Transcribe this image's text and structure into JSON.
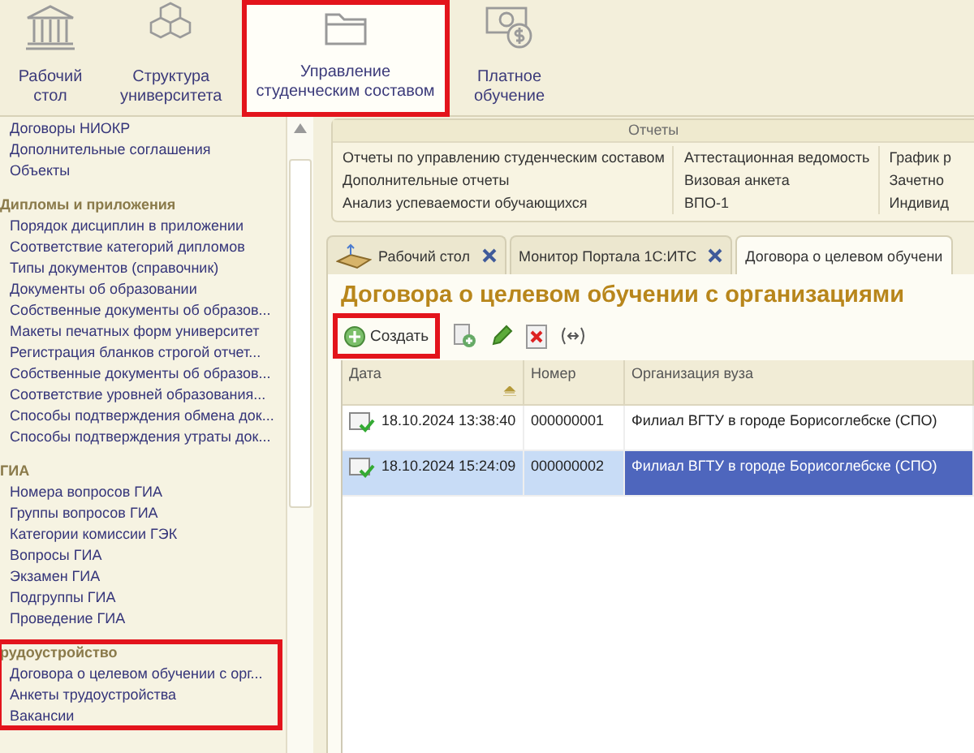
{
  "nav": [
    {
      "kind": "building",
      "lines": [
        "Рабочий",
        "стол"
      ],
      "selected": false,
      "highlighted": false
    },
    {
      "kind": "cubes",
      "lines": [
        "Структура",
        "университета"
      ],
      "selected": false,
      "highlighted": false
    },
    {
      "kind": "folder",
      "lines": [
        "Управление",
        "студенческим составом"
      ],
      "selected": true,
      "highlighted": true
    },
    {
      "kind": "money",
      "lines": [
        "Платное",
        "обучение"
      ],
      "selected": false,
      "highlighted": false
    }
  ],
  "sidebar": {
    "groups": [
      {
        "items": [
          {
            "label": "Договоры НИОКР"
          },
          {
            "label": "Дополнительные соглашения"
          },
          {
            "label": "Объекты"
          }
        ]
      },
      {
        "heading": "Дипломы и приложения",
        "items": [
          {
            "label": "Порядок дисциплин в приложении"
          },
          {
            "label": "Соответствие категорий дипломов"
          },
          {
            "label": "Типы документов (справочник)"
          },
          {
            "label": "Документы об образовании"
          },
          {
            "label": "Собственные документы об образов..."
          },
          {
            "label": "Макеты печатных форм университет"
          },
          {
            "label": "Регистрация бланков строгой отчет..."
          },
          {
            "label": "Собственные документы об образов..."
          },
          {
            "label": "Соответствие уровней образования..."
          },
          {
            "label": "Способы подтверждения обмена док..."
          },
          {
            "label": "Способы подтверждения утраты док..."
          }
        ]
      },
      {
        "heading": "ГИА",
        "items": [
          {
            "label": "Номера вопросов ГИА"
          },
          {
            "label": "Группы вопросов ГИА"
          },
          {
            "label": "Категории комиссии ГЭК"
          },
          {
            "label": "Вопросы ГИА"
          },
          {
            "label": "Экзамен ГИА"
          },
          {
            "label": "Подгруппы ГИА"
          },
          {
            "label": "Проведение ГИА"
          }
        ]
      },
      {
        "heading": "рудоустройство",
        "highlighted": true,
        "items": [
          {
            "label": "Договора о целевом обучении с орг..."
          },
          {
            "label": "Анкеты трудоустройства"
          },
          {
            "label": "Вакансии"
          }
        ]
      }
    ]
  },
  "reports": {
    "title": "Отчеты",
    "columns": [
      [
        "Отчеты по управлению студенческим составом",
        "Дополнительные отчеты",
        "Анализ успеваемости обучающихся"
      ],
      [
        "Аттестационная ведомость",
        "Визовая анкета",
        "ВПО-1"
      ],
      [
        "График р",
        "Зачетно",
        "Индивид"
      ]
    ]
  },
  "tabs": [
    {
      "label": "Рабочий стол",
      "icon": true,
      "closable": true,
      "selected": false
    },
    {
      "label": "Монитор Портала 1С:ИТС",
      "icon": false,
      "closable": true,
      "selected": false
    },
    {
      "label": "Договора о целевом обучени",
      "icon": false,
      "closable": false,
      "selected": true
    }
  ],
  "form": {
    "title": "Договора о целевом обучении с организациями",
    "toolbar": [
      {
        "kind": "create",
        "label": "Создать",
        "highlighted": true
      },
      {
        "kind": "copy"
      },
      {
        "kind": "edit"
      },
      {
        "kind": "delete"
      },
      {
        "kind": "link"
      }
    ],
    "table": {
      "columns": [
        {
          "label": "Дата",
          "sorted": true
        },
        {
          "label": "Номер",
          "sorted": false
        },
        {
          "label": "Организация вуза",
          "sorted": false
        }
      ],
      "rows": [
        {
          "selected": false,
          "cells": [
            "18.10.2024 13:38:40",
            "000000001",
            "Филиал ВГТУ в городе Борисоглебске (СПО)"
          ]
        },
        {
          "selected": true,
          "cells": [
            "18.10.2024 15:24:09",
            "000000002",
            "Филиал ВГТУ в городе Борисоглебске (СПО)"
          ]
        }
      ]
    }
  }
}
